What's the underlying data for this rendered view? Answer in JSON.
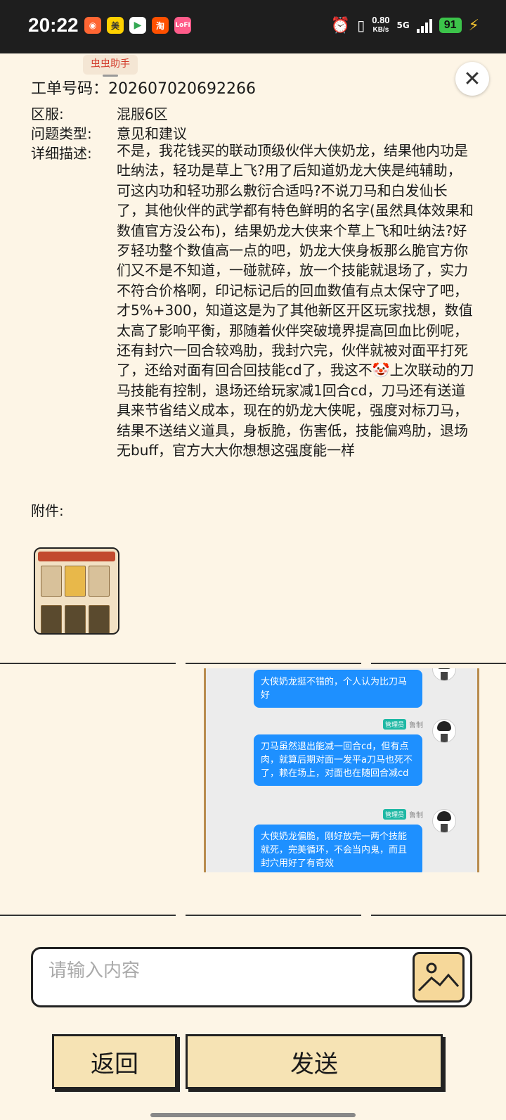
{
  "status_bar": {
    "time": "20:22",
    "net_speed": "0.80",
    "net_unit": "KB/s",
    "signal_type": "5G",
    "battery": "91",
    "app_icons": [
      "dianping-icon",
      "meituan-icon",
      "play-store-icon",
      "taobao-icon",
      "lofter-icon"
    ]
  },
  "watermark": "虫虫助手",
  "ticket": {
    "number_label": "工单号码：",
    "number": "202607020692266",
    "server_label": "区服:",
    "server": "混服6区",
    "type_label": "问题类型:",
    "type": "意见和建议",
    "desc_label": "详细描述:",
    "description_part1": "不是，我花钱买的联动顶级伙伴大侠奶龙，结果他内功是吐纳法，轻功是草上飞?用了后知道奶龙大侠是纯辅助，可这内功和轻功那么敷衍合适吗?不说刀马和白发仙长了，其他伙伴的武学都有特色鲜明的名字(虽然具体效果和数值官方没公布)，结果奶龙大侠来个草上飞和吐纳法?好歹轻功整个数值高一点的吧，奶龙大侠身板那么脆官方你们又不是不知道，一碰就碎，放一个技能就退场了，实力不符合价格啊，印记标记后的回血数值有点太保守了吧，才5%+300，知道这是为了其他新区开区玩家找想，数值太高了影响平衡，那随着伙伴突破境界提高回血比例呢，还有封穴一回合较鸡肋，我封穴完，伙伴就被对面平打死了，还给对面有回合回技能cd了，我这不",
    "description_emoji": "🤡",
    "description_part2": "上次联动的刀马技能有控制，退场还给玩家减1回合cd，刀马还有送道具来节省结义成本，现在的奶龙大侠呢，强度对标刀马，结果不送结义道具，身板脆，伤害低，技能偏鸡肋，退场无buff，官方大大你想想这强度能一样",
    "attachment_label": "附件:"
  },
  "chat": {
    "messages": [
      "大侠奶龙挺不错的，个人认为比刀马好",
      "刀马虽然退出能减一回合cd，但有点肉，就算后期对面一发平a刀马也死不了，赖在场上，对面也在随回合减cd",
      "大侠奶龙偏脆，刚好放完一两个技能就死，完美循环，不会当内鬼，而且封穴用好了有奇效"
    ],
    "admin_badge": "管理员",
    "admin_name": "鲁制"
  },
  "input": {
    "placeholder": "请输入内容"
  },
  "buttons": {
    "back": "返回",
    "send": "发送"
  }
}
